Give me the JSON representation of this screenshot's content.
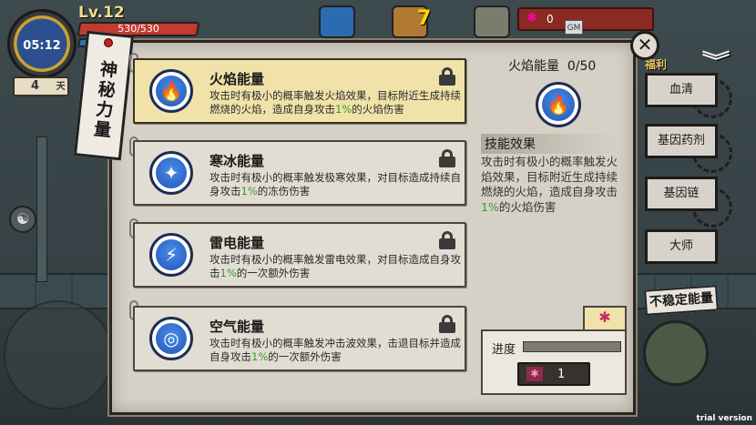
{
  "hud": {
    "time": "05:12",
    "level": "Lv.12",
    "hp": "530/530",
    "day": "4",
    "day_unit": "天",
    "chest_count": "7",
    "currency_value": "0",
    "gm": "GM"
  },
  "panel": {
    "title": "神秘力量",
    "close_symbol": "✕",
    "skills": [
      {
        "name": "火焰能量",
        "desc_before": "攻击时有极小的概率触发火焰效果，目标附近生成持续燃烧的火焰，造成自身攻击",
        "desc_pct": "1%",
        "desc_after": "的火焰伤害",
        "glyph": "🔥",
        "icon": "flame-icon"
      },
      {
        "name": "寒冰能量",
        "desc_before": "攻击时有极小的概率触发极寒效果，对目标造成持续自身攻击",
        "desc_pct": "1%",
        "desc_after": "的冻伤伤害",
        "glyph": "✦",
        "icon": "snowflake-icon"
      },
      {
        "name": "雷电能量",
        "desc_before": "攻击时有极小的概率触发雷电效果，对目标造成自身攻击",
        "desc_pct": "1%",
        "desc_after": "的一次额外伤害",
        "glyph": "⚡",
        "icon": "lightning-icon"
      },
      {
        "name": "空气能量",
        "desc_before": "攻击时有极小的概率触发冲击波效果，击退目标并造成自身攻击",
        "desc_pct": "1%",
        "desc_after": "的一次额外伤害",
        "glyph": "◎",
        "icon": "air-vortex-icon"
      }
    ],
    "detail": {
      "title": "火焰能量  0/50",
      "effect_label": "技能效果",
      "effect_before": "攻击时有极小的概率触发火焰效果，目标附近生成持续燃烧的火焰，造成自身攻击",
      "effect_pct": "1%",
      "effect_after": "的火焰伤害",
      "glyph": "🔥"
    },
    "progress": {
      "label": "进度",
      "fraction": 0.0,
      "cost": "1"
    }
  },
  "side_menu": {
    "header": "福利",
    "items": [
      "血清",
      "基因药剂",
      "基因链",
      "大师"
    ],
    "unstable": "不稳定能量"
  },
  "footer": {
    "trial": "trial version"
  },
  "colors": {
    "highlight_green": "#3a9d2c",
    "selected_card": "#f0e2a8",
    "hp_red": "#c33a2f"
  }
}
